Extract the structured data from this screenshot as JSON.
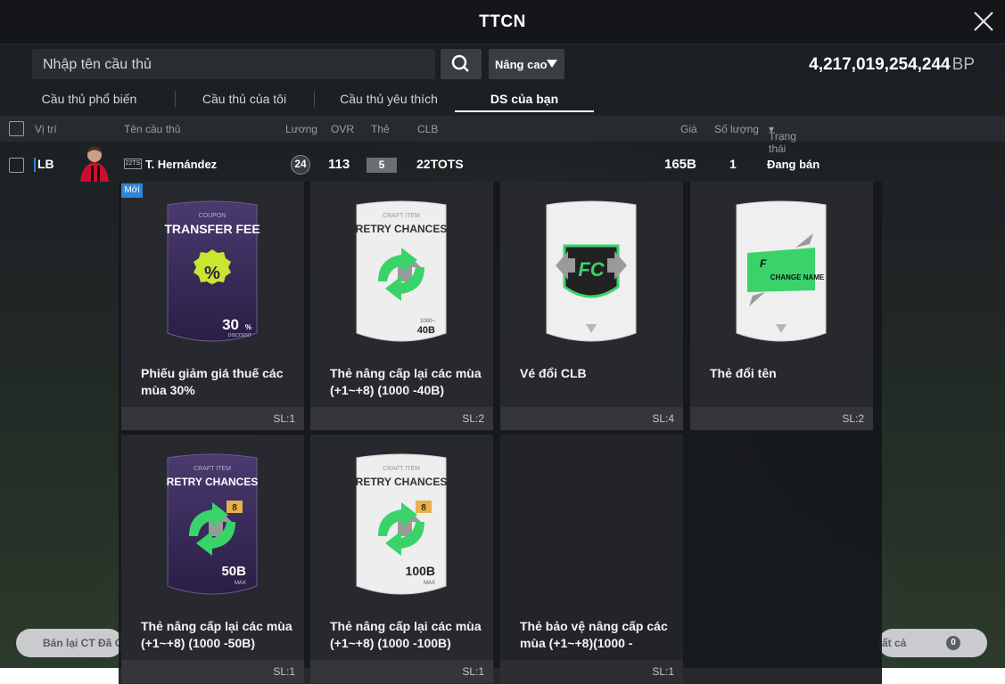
{
  "window": {
    "title": "TTCN"
  },
  "search": {
    "placeholder": "Nhập tên cầu thủ",
    "advanced_label": "Nâng cao"
  },
  "balance": {
    "amount": "4,217,019,254,244",
    "unit": "BP"
  },
  "tabs": [
    {
      "label": "Cầu thủ phổ biến"
    },
    {
      "label": "Cầu thủ của tôi"
    },
    {
      "label": "Cầu thủ yêu thích"
    },
    {
      "label": "DS của bạn",
      "active": true
    }
  ],
  "columns": {
    "position": "Vị trí",
    "name": "Tên cầu thủ",
    "salary": "Lương",
    "ovr": "OVR",
    "card": "Thẻ",
    "club": "CLB",
    "price": "Giá",
    "quantity": "Số lượng",
    "status": "Trạng thái"
  },
  "player": {
    "position": "LB",
    "season_badge": "22TS",
    "name": "T. Hernández",
    "salary": "24",
    "ovr": "113",
    "card_level": "5",
    "club": "22TOTS",
    "price": "165B",
    "quantity": "1",
    "status": "Đang bán"
  },
  "popup": {
    "new_badge": "Mới",
    "items": [
      {
        "name": "Phiếu giảm giá thuế các mùa 30%",
        "count": "SL:1",
        "card": {
          "tag": "COUPON",
          "title": "TRANSFER FEE",
          "badge": "%",
          "badge_sub": "COUPON",
          "value": "30",
          "value_unit": "%",
          "value_sub": "DISCOUNT"
        }
      },
      {
        "name": "Thẻ nâng cấp lại các mùa (+1~+8) (1000 -40B)",
        "count": "SL:2",
        "card": {
          "tag": "CRAFT ITEM",
          "title": "RETRY CHANCES",
          "value_sub": "1000~",
          "value": "40B"
        }
      },
      {
        "name": "Vé đổi CLB",
        "count": "SL:4",
        "card": {}
      },
      {
        "name": "Thẻ đổi tên",
        "count": "SL:2",
        "card": {
          "title": "CHANGE NAME"
        }
      },
      {
        "name": "Thẻ nâng cấp lại các mùa (+1~+8) (1000 -50B)",
        "count": "SL:1",
        "card": {
          "tag": "CRAFT ITEM",
          "title": "RETRY CHANCES",
          "level": "8",
          "value": "50B",
          "value_sub": "MAX"
        }
      },
      {
        "name": "Thẻ nâng cấp lại các mùa (+1~+8) (1000 -100B)",
        "count": "SL:1",
        "card": {
          "tag": "CRAFT ITEM",
          "title": "RETRY CHANCES",
          "level": "8",
          "value": "100B",
          "value_sub": "MAX"
        }
      },
      {
        "name": "Thẻ bảo vệ nâng cấp các mùa (+1~+8)(1000 -",
        "count": "SL:1"
      }
    ]
  },
  "bottom": {
    "left_label": "Bán lại CT Đã C",
    "right_label": "tất cả",
    "right_count": "0"
  },
  "colors": {
    "accent": "#2d86d9",
    "green": "#2fd06a",
    "purple": "#3a2c5c",
    "lime": "#c8e632"
  }
}
